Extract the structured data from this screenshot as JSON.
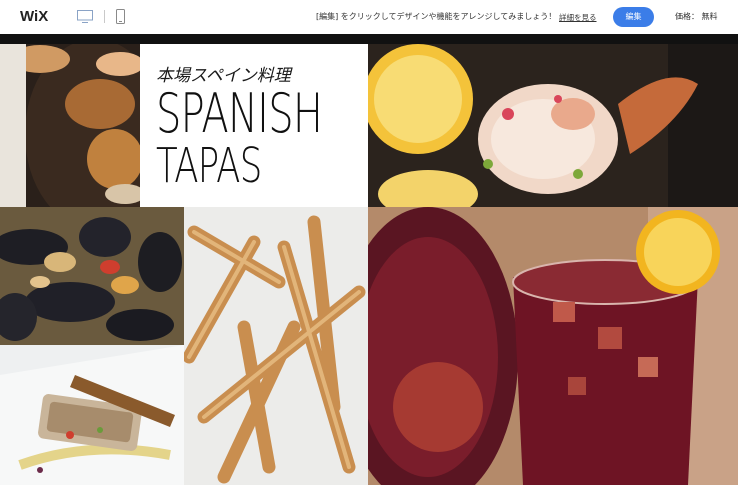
{
  "topbar": {
    "logo": "WiX",
    "promo_text": "[編集] をクリックしてデザインや機能をアレンジしてみましょう！",
    "details_link": "詳細を見る",
    "edit_button": "編集",
    "price_label": "価格： 無料"
  },
  "hero": {
    "subtitle": "本場スペイン料理",
    "title_line1": "SPANISH",
    "title_line2": "TAPAS"
  },
  "colors": {
    "accent": "#3b7de8",
    "topbar_bg": "#ffffff",
    "strip": "#111111"
  }
}
